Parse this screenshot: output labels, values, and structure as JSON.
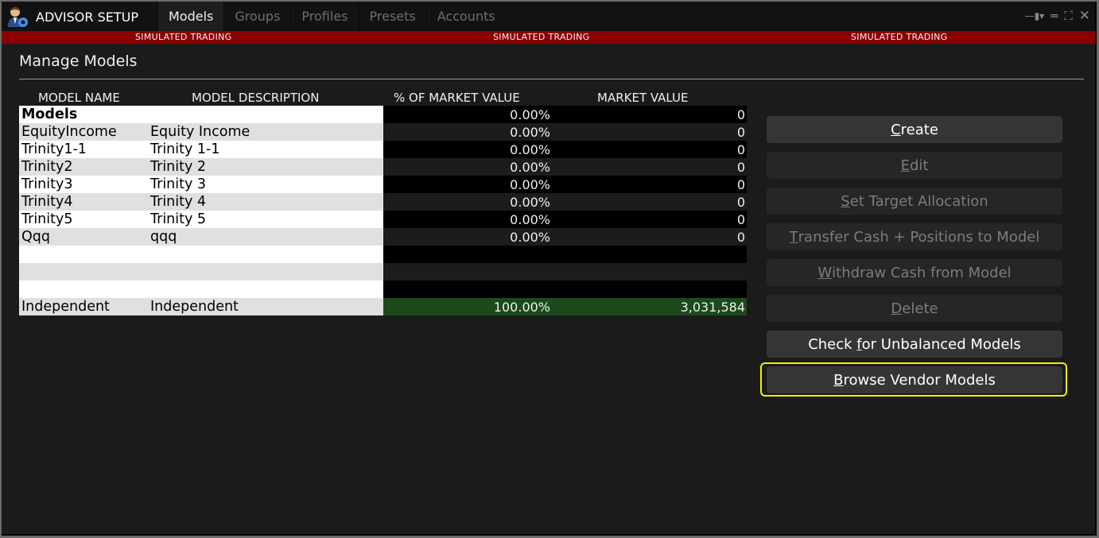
{
  "window": {
    "title": "ADVISOR SETUP",
    "app_icon": "advisor-user-gear-icon",
    "tabs": [
      {
        "label": "Models",
        "active": true
      },
      {
        "label": "Groups",
        "active": false
      },
      {
        "label": "Profiles",
        "active": false
      },
      {
        "label": "Presets",
        "active": false
      },
      {
        "label": "Accounts",
        "active": false
      }
    ],
    "controls": {
      "pin": "—▮▾",
      "minimize": "═",
      "maximize": "⛶",
      "close": "✕"
    }
  },
  "banner": {
    "text": "SIMULATED TRADING",
    "color": "#8b0000"
  },
  "page": {
    "title": "Manage Models"
  },
  "table": {
    "headers": {
      "model_name": "MODEL NAME",
      "model_description": "MODEL DESCRIPTION",
      "pct_market_value": "% OF MARKET VALUE",
      "market_value": "MARKET VALUE"
    },
    "group_label": "Models",
    "group_pct": "0.00%",
    "group_mv": "0",
    "rows": [
      {
        "name": "EquityIncome",
        "description": "Equity Income",
        "pct": "0.00%",
        "mv": "0"
      },
      {
        "name": "Trinity1-1",
        "description": "Trinity 1-1",
        "pct": "0.00%",
        "mv": "0"
      },
      {
        "name": "Trinity2",
        "description": "Trinity 2",
        "pct": "0.00%",
        "mv": "0"
      },
      {
        "name": "Trinity3",
        "description": "Trinity 3",
        "pct": "0.00%",
        "mv": "0"
      },
      {
        "name": "Trinity4",
        "description": "Trinity 4",
        "pct": "0.00%",
        "mv": "0"
      },
      {
        "name": "Trinity5",
        "description": "Trinity 5",
        "pct": "0.00%",
        "mv": "0"
      },
      {
        "name": "Qqq",
        "description": "qqq",
        "pct": "0.00%",
        "mv": "0"
      }
    ],
    "independent": {
      "name": "Independent",
      "description": "Independent",
      "pct": "100.00%",
      "mv": "3,031,584"
    }
  },
  "buttons": {
    "create": {
      "mnemonic": "C",
      "rest": "reate",
      "enabled": true
    },
    "edit": {
      "mnemonic": "E",
      "rest": "dit",
      "enabled": false
    },
    "set_target": {
      "mnemonic": "S",
      "rest": "et Target Allocation",
      "enabled": false
    },
    "transfer": {
      "mnemonic": "T",
      "rest": "ransfer Cash + Positions to Model",
      "enabled": false
    },
    "withdraw": {
      "mnemonic": "W",
      "rest": "ithdraw Cash from Model",
      "enabled": false
    },
    "delete": {
      "mnemonic": "D",
      "rest": "elete",
      "enabled": false
    },
    "check_unbalanced": {
      "pre": "Check ",
      "mnemonic": "f",
      "rest": "or Unbalanced Models",
      "enabled": true
    },
    "browse_vendor": {
      "mnemonic": "B",
      "rest": "rowse Vendor Models",
      "enabled": true,
      "focused": true
    }
  }
}
